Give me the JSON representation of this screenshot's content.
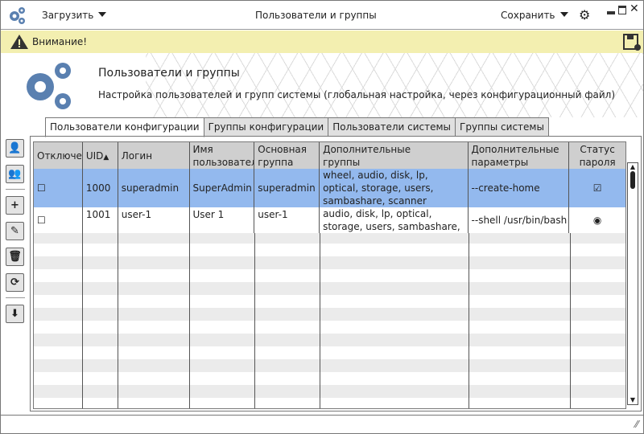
{
  "titlebar": {
    "load_label": "Загрузить",
    "title": "Пользователи и группы",
    "save_label": "Сохранить"
  },
  "warning": {
    "text": "Внимание!"
  },
  "header": {
    "title": "Пользователи и группы",
    "subtitle": "Настройка пользователей и групп системы (глобальная настройка, через конфигурационный файл)"
  },
  "tabs": [
    {
      "label": "Пользователи конфигурации",
      "active": true
    },
    {
      "label": "Группы конфигурации"
    },
    {
      "label": "Пользователи системы"
    },
    {
      "label": "Группы системы"
    }
  ],
  "table": {
    "columns": [
      "Отключен",
      "UID",
      "Логин",
      "Имя пользователя",
      "Основная группа",
      "Дополнительные группы",
      "Дополнительные параметры",
      "Статус пароля"
    ],
    "sort": {
      "column": "UID",
      "direction": "asc"
    },
    "rows": [
      {
        "disabled": false,
        "uid": "1000",
        "login": "superadmin",
        "name": "SuperAdmin",
        "group": "superadmin",
        "groups": "wheel, audio, disk, lp, optical, storage, users, sambashare, scanner",
        "params": "--create-home",
        "password_status": "checked",
        "selected": true
      },
      {
        "disabled": false,
        "uid": "1001",
        "login": "user-1",
        "name": "User 1",
        "group": "user-1",
        "groups": "audio, disk, lp, optical, storage, users, sambashare, scanner",
        "params": "--shell /usr/bin/bash",
        "password_status": "radio"
      }
    ]
  },
  "colors": {
    "selected_row": "#93b9ee",
    "warning_bg": "#f3efb0",
    "icon_blue": "#5a80b0"
  }
}
